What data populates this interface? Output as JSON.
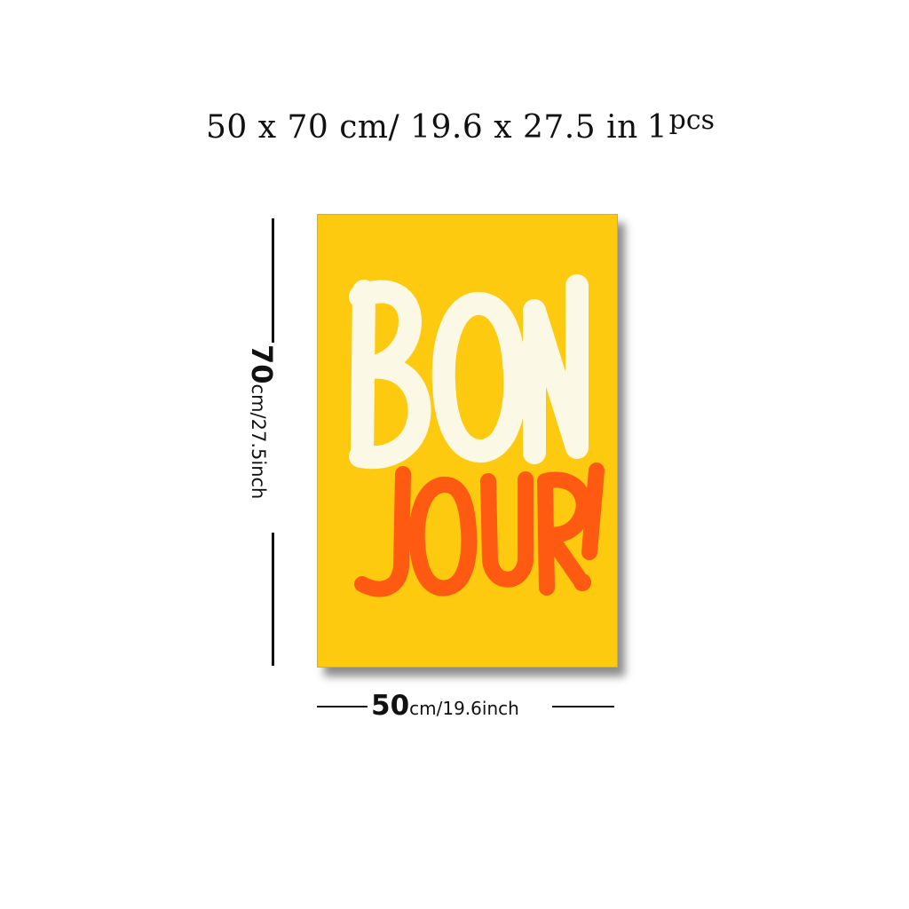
{
  "header": {
    "size_text": "50 x 70 cm/ 19.6 x 27.5 in",
    "quantity": "1",
    "quantity_unit": "pcs"
  },
  "poster": {
    "line1": "BON",
    "line2": "JOUR!",
    "background_color": "#fdca10",
    "line1_color": "#fbf8e6",
    "line2_color": "#ff5a12"
  },
  "dimensions": {
    "height_value": "70",
    "height_unit": "cm/27.5inch",
    "width_value": "50",
    "width_unit": "cm/19.6inch"
  }
}
